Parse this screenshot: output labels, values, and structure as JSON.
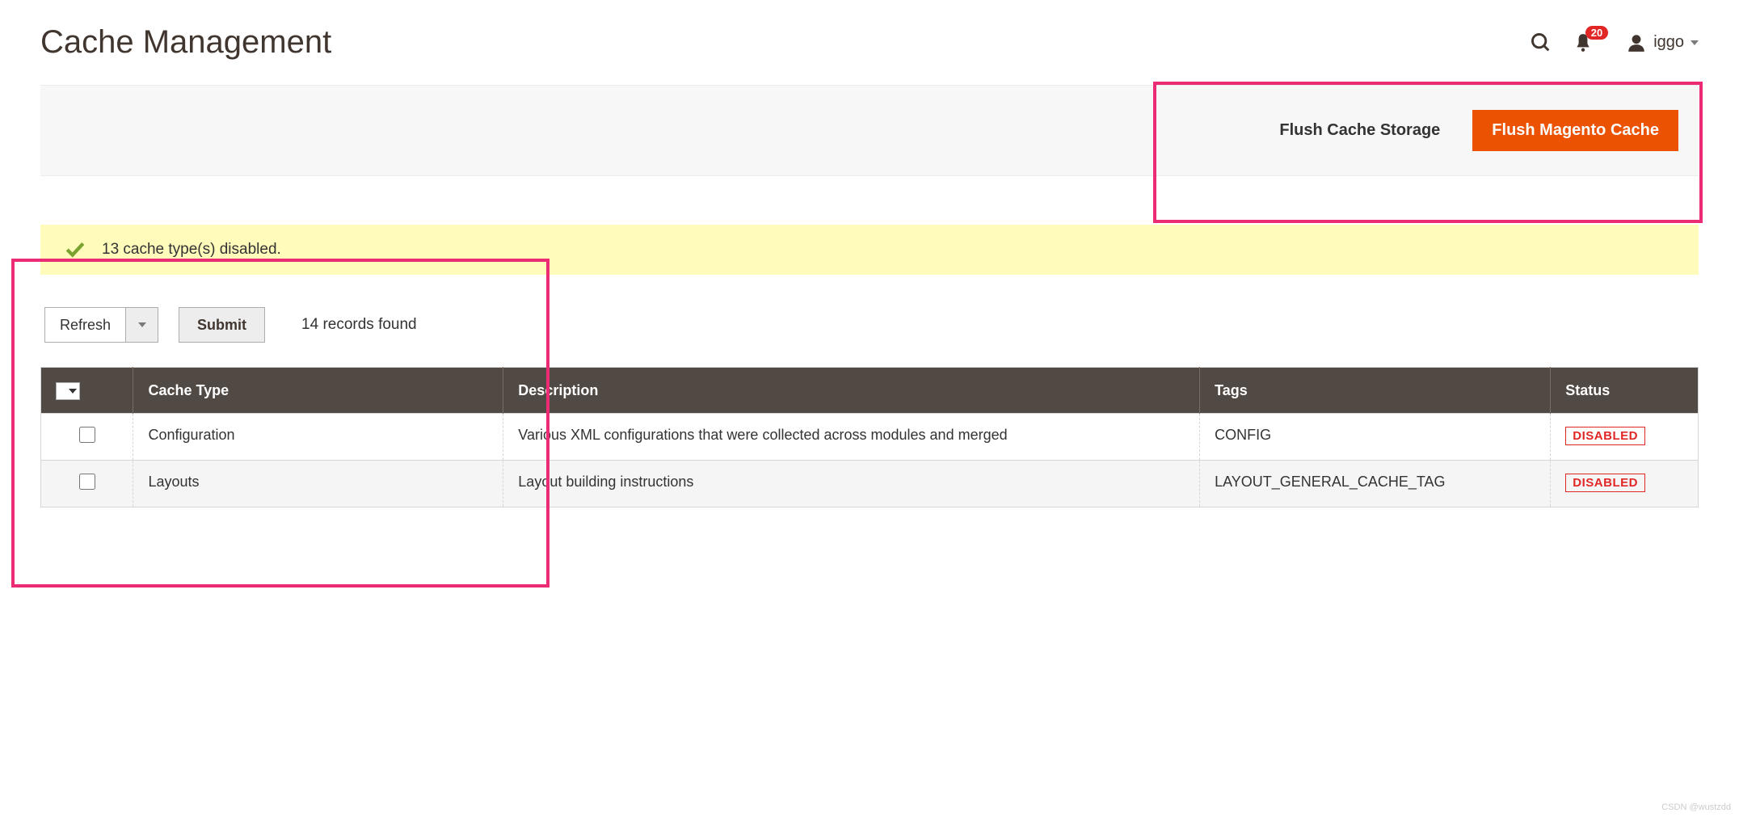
{
  "header": {
    "title": "Cache Management",
    "notifications": "20",
    "username": "iggo"
  },
  "actions": {
    "flush_storage": "Flush Cache Storage",
    "flush_magento": "Flush Magento Cache"
  },
  "message": {
    "text": "13 cache type(s) disabled."
  },
  "controls": {
    "select_value": "Refresh",
    "submit": "Submit",
    "records": "14 records found"
  },
  "table": {
    "headers": {
      "cache_type": "Cache Type",
      "description": "Description",
      "tags": "Tags",
      "status": "Status"
    },
    "rows": [
      {
        "type": "Configuration",
        "description": "Various XML configurations that were collected across modules and merged",
        "tags": "CONFIG",
        "status": "DISABLED"
      },
      {
        "type": "Layouts",
        "description": "Layout building instructions",
        "tags": "LAYOUT_GENERAL_CACHE_TAG",
        "status": "DISABLED"
      }
    ]
  },
  "watermark": "CSDN @wustzdd"
}
